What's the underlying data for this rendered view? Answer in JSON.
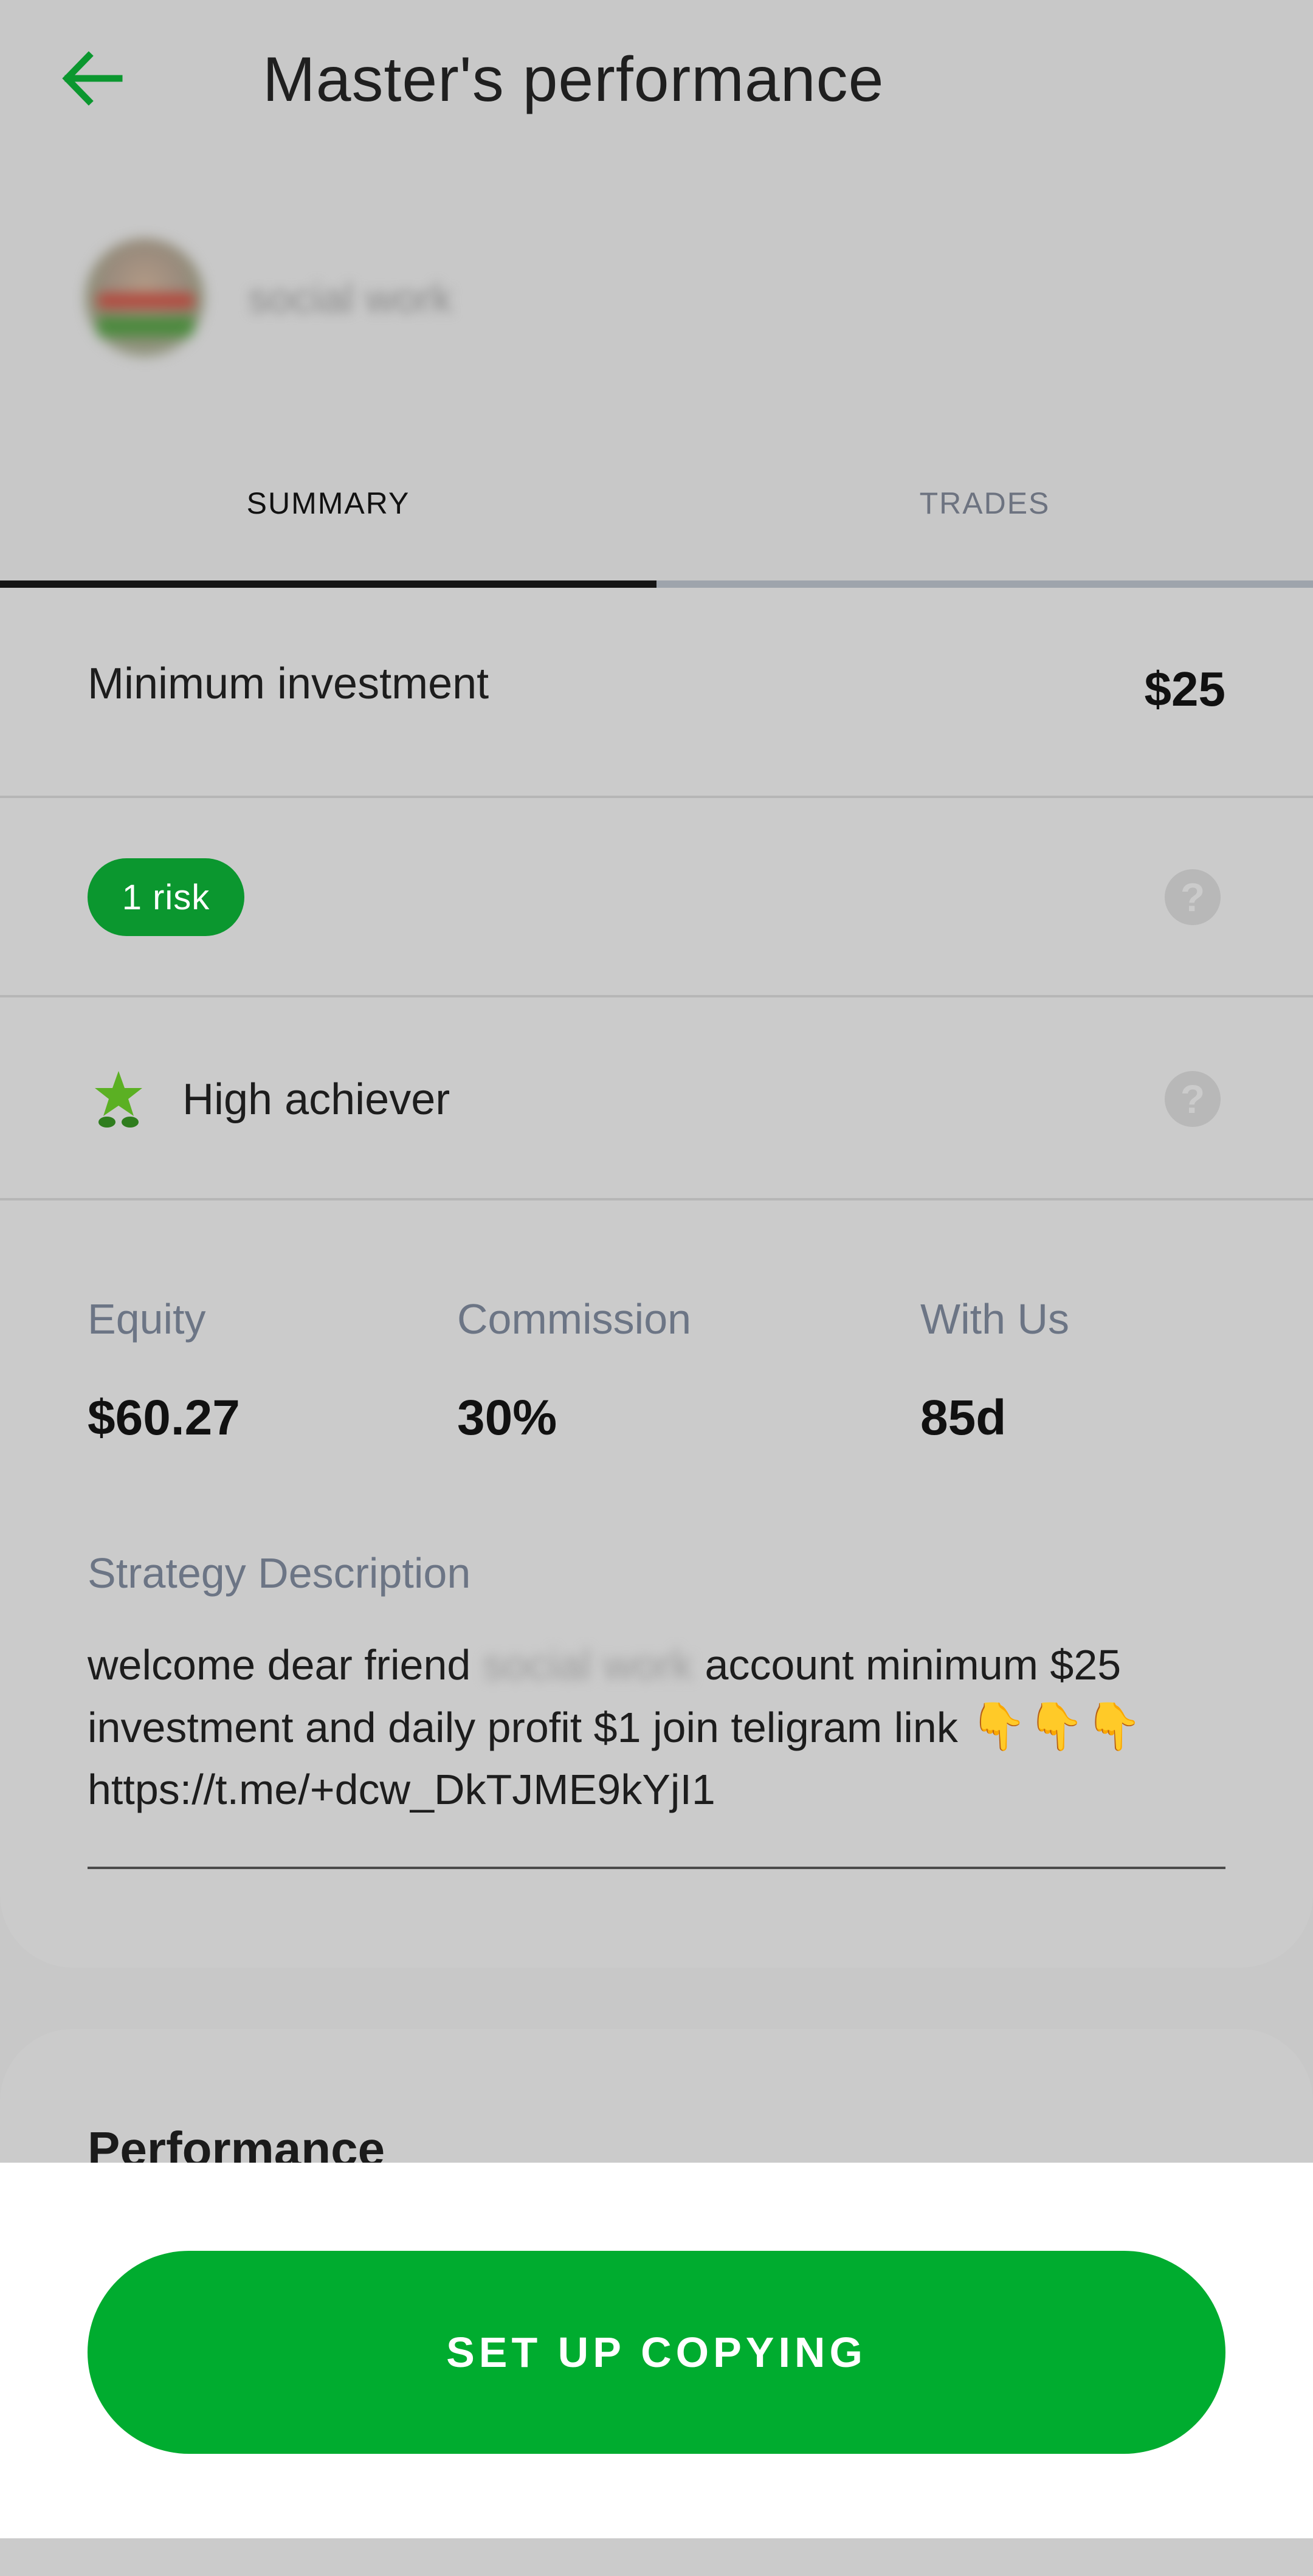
{
  "header": {
    "title": "Master's performance",
    "back_icon": "arrow-left-icon"
  },
  "master": {
    "name": "social work"
  },
  "tabs": [
    {
      "label": "SUMMARY",
      "active": true
    },
    {
      "label": "TRADES",
      "active": false
    }
  ],
  "summary": {
    "min_investment_label": "Minimum investment",
    "min_investment_value": "$25",
    "risk_badge": "1 risk",
    "achiever_label": "High achiever",
    "help_glyph": "?",
    "stats": [
      {
        "label": "Equity",
        "value": "$60.27"
      },
      {
        "label": "Commission",
        "value": "30%"
      },
      {
        "label": "With Us",
        "value": "85d"
      }
    ],
    "description_label": "Strategy Description",
    "description": {
      "before_name": "welcome dear friend",
      "name": "social work",
      "after_name": "account minimum $25 investment and daily profit $1 join teligram link",
      "emojis": "👇👇👇",
      "link": "https://t.me/+dcw_DkTJME9kYjI1"
    }
  },
  "performance": {
    "title": "Performance"
  },
  "cta": {
    "label": "SET UP COPYING"
  },
  "colors": {
    "accent_green": "#00ac2f",
    "risk_green": "#0b972f",
    "background_gray": "#c8c8c8",
    "label_gray": "#6c7585"
  }
}
